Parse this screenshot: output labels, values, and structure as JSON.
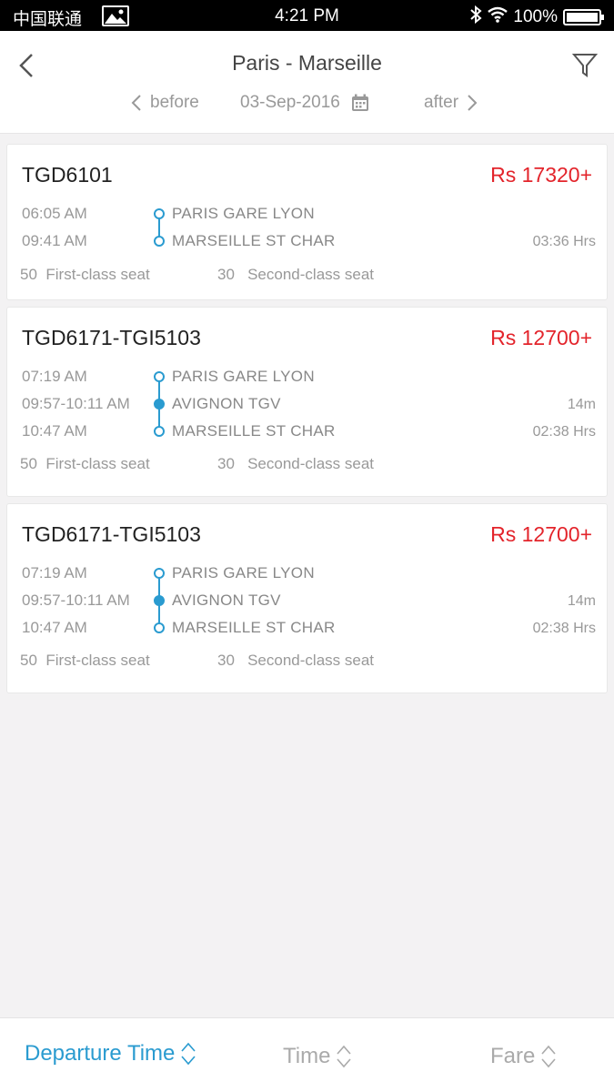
{
  "status_bar": {
    "carrier": "中国联通",
    "time": "4:21 PM",
    "battery": "100%"
  },
  "header": {
    "title": "Paris - Marseille",
    "before_label": "before",
    "date": "03-Sep-2016",
    "after_label": "after"
  },
  "trains": [
    {
      "code": "TGD6101",
      "price": "Rs 17320+",
      "stops": [
        {
          "time": "06:05 AM",
          "station": "PARIS GARE LYON",
          "right": ""
        },
        {
          "time": "09:41 AM",
          "station": "MARSEILLE ST CHAR",
          "right": "03:36 Hrs"
        }
      ],
      "first_count": "50",
      "first_label": "First-class seat",
      "second_count": "30",
      "second_label": "Second-class seat"
    },
    {
      "code": "TGD6171-TGI5103",
      "price": "Rs 12700+",
      "stops": [
        {
          "time": "07:19 AM",
          "station": "PARIS GARE LYON",
          "right": ""
        },
        {
          "time": "09:57-10:11 AM",
          "station": "AVIGNON TGV",
          "right": "14m"
        },
        {
          "time": "10:47 AM",
          "station": "MARSEILLE ST CHAR",
          "right": "02:38 Hrs"
        }
      ],
      "first_count": "50",
      "first_label": "First-class seat",
      "second_count": "30",
      "second_label": "Second-class seat"
    },
    {
      "code": "TGD6171-TGI5103",
      "price": "Rs 12700+",
      "stops": [
        {
          "time": "07:19 AM",
          "station": "PARIS GARE LYON",
          "right": ""
        },
        {
          "time": "09:57-10:11 AM",
          "station": "AVIGNON TGV",
          "right": "14m"
        },
        {
          "time": "10:47 AM",
          "station": "MARSEILLE ST CHAR",
          "right": "02:38 Hrs"
        }
      ],
      "first_count": "50",
      "first_label": "First-class seat",
      "second_count": "30",
      "second_label": "Second-class seat"
    }
  ],
  "sort_bar": {
    "departure_label": "Departure Time",
    "time_label": "Time",
    "fare_label": "Fare"
  },
  "colors": {
    "accent": "#2a9bd0",
    "price": "#e3242b"
  }
}
